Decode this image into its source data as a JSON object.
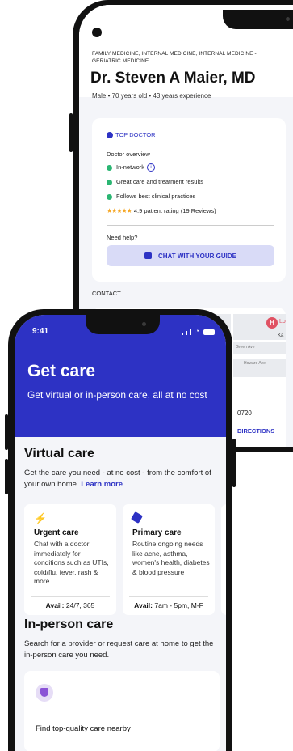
{
  "back_phone": {
    "specialties": "FAMILY MEDICINE, INTERNAL MEDICINE, INTERNAL MEDICINE - GERIATRIC MEDICINE",
    "doctor_name": "Dr. Steven A Maier, MD",
    "doctor_meta": "Male • 70 years old • 43 years experience",
    "top_doctor_badge": "TOP DOCTOR",
    "overview_label": "Doctor overview",
    "overview_items": [
      "In-network",
      "Great care and treatment results",
      "Follows best clinical practices",
      "4.9 patient rating (19 Reviews)"
    ],
    "help_label": "Need help?",
    "chat_button": "CHAT WITH YOUR GUIDE",
    "contact_label": "CONTACT",
    "map_labels": [
      "Lo",
      "Ka",
      "Green Ave",
      "Howard Ave"
    ],
    "map_pin": "H",
    "zip_partial": "0720",
    "directions_partial": "DIRECTIONS"
  },
  "front_phone": {
    "status_time": "9:41",
    "hero_title": "Get care",
    "hero_subtitle": "Get virtual or in-person care, all at no cost",
    "virtual": {
      "title": "Virtual care",
      "text": "Get the care you need - at no cost - from the comfort of your own home.",
      "link": "Learn more"
    },
    "cards": [
      {
        "icon": "lightning-icon",
        "title": "Urgent care",
        "desc": "Chat with a doctor immediately for conditions such as UTIs, cold/flu, fever, rash & more",
        "avail_label": "Avail:",
        "avail_value": "24/7, 365"
      },
      {
        "icon": "cube-icon",
        "title": "Primary care",
        "desc": "Routine ongoing needs like acne, asthma, women's health, diabetes & blood pressure",
        "avail_label": "Avail:",
        "avail_value": "7am - 5pm, M-F"
      }
    ],
    "inperson": {
      "title": "In-person care",
      "text": "Search for a provider or request care at home to get the in-person care you need."
    },
    "find_label": "Find top-quality care nearby"
  },
  "colors": {
    "brand": "#2d32c4",
    "check": "#2bb673",
    "star": "#f5a623"
  }
}
